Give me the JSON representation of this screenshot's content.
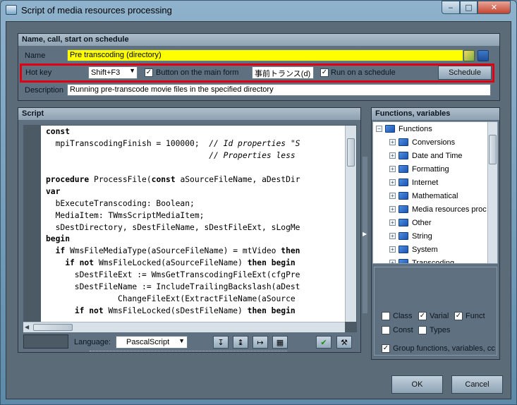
{
  "window": {
    "title": "Script of media resources processing"
  },
  "header_section": {
    "title": "Name, call, start on schedule",
    "name_label": "Name",
    "name_value": "Pre transcoding (directory)",
    "hotkey_label": "Hot key",
    "hotkey_value": "Shift+F3",
    "button_main_form_label": "Button on the main form",
    "button_main_form_checked": true,
    "button_caption_value": "事前トランス(d)",
    "run_schedule_label": "Run on a schedule",
    "run_schedule_checked": true,
    "schedule_button": "Schedule",
    "description_label": "Description",
    "description_value": "Running pre-transcode movie files in the specified directory"
  },
  "script_section": {
    "title": "Script",
    "language_label": "Language:",
    "language_value": "PascalScript",
    "code_lines": [
      [
        {
          "t": "const",
          "c": "kw"
        }
      ],
      [
        {
          "t": "  mpiTranscodingFinish = 100000;  ",
          "c": ""
        },
        {
          "t": "// Id properties \"S",
          "c": "cm"
        }
      ],
      [
        {
          "t": "                                  ",
          "c": ""
        },
        {
          "t": "// Properties less",
          "c": "cm"
        }
      ],
      [
        {
          "t": "",
          "c": ""
        }
      ],
      [
        {
          "t": "procedure",
          "c": "kw"
        },
        {
          "t": " ProcessFile(",
          "c": ""
        },
        {
          "t": "const",
          "c": "kw"
        },
        {
          "t": " aSourceFileName, aDestDir",
          "c": ""
        }
      ],
      [
        {
          "t": "var",
          "c": "kw"
        }
      ],
      [
        {
          "t": "  bExecuteTranscoding: Boolean;",
          "c": ""
        }
      ],
      [
        {
          "t": "  MediaItem: TWmsScriptMediaItem;",
          "c": ""
        }
      ],
      [
        {
          "t": "  sDestDirectory, sDestFileName, sDestFileExt, sLogMe",
          "c": ""
        }
      ],
      [
        {
          "t": "begin",
          "c": "kw"
        }
      ],
      [
        {
          "t": "  ",
          "c": ""
        },
        {
          "t": "if",
          "c": "kw"
        },
        {
          "t": " WmsFileMediaType(aSourceFileName) = mtVideo ",
          "c": ""
        },
        {
          "t": "then",
          "c": "kw"
        }
      ],
      [
        {
          "t": "    ",
          "c": ""
        },
        {
          "t": "if not",
          "c": "kw"
        },
        {
          "t": " WmsFileLocked(aSourceFileName) ",
          "c": ""
        },
        {
          "t": "then begin",
          "c": "kw"
        }
      ],
      [
        {
          "t": "      sDestFileExt := WmsGetTranscodingFileExt(cfgPre",
          "c": ""
        }
      ],
      [
        {
          "t": "      sDestFileName := IncludeTrailingBackslash(aDest",
          "c": ""
        }
      ],
      [
        {
          "t": "               ChangeFileExt(ExtractFileName(aSource",
          "c": ""
        }
      ],
      [
        {
          "t": "      ",
          "c": ""
        },
        {
          "t": "if not",
          "c": "kw"
        },
        {
          "t": " WmsFileLocked(sDestFileName) ",
          "c": ""
        },
        {
          "t": "then begin",
          "c": "kw"
        }
      ],
      [
        {
          "t": "        ",
          "c": ""
        }
      ]
    ]
  },
  "functions_section": {
    "title": "Functions, variables",
    "root": "Functions",
    "items": [
      "Conversions",
      "Date and Time",
      "Formatting",
      "Internet",
      "Mathematical",
      "Media resources proc",
      "Other",
      "String",
      "System",
      "Transcoding"
    ],
    "filters": [
      {
        "label": "Class",
        "checked": false
      },
      {
        "label": "Varial",
        "checked": true
      },
      {
        "label": "Funct",
        "checked": true
      },
      {
        "label": "Const",
        "checked": false
      },
      {
        "label": "Types",
        "checked": false
      }
    ],
    "group_label": "Group functions, variables, cc",
    "group_checked": true
  },
  "footer": {
    "ok": "OK",
    "cancel": "Cancel"
  },
  "colors": {
    "name_field_bg": "#ffff00",
    "highlight_border": "#e00010"
  },
  "icons": {
    "minimize": "minimize-icon",
    "maximize": "maximize-icon",
    "close": "close-icon"
  }
}
